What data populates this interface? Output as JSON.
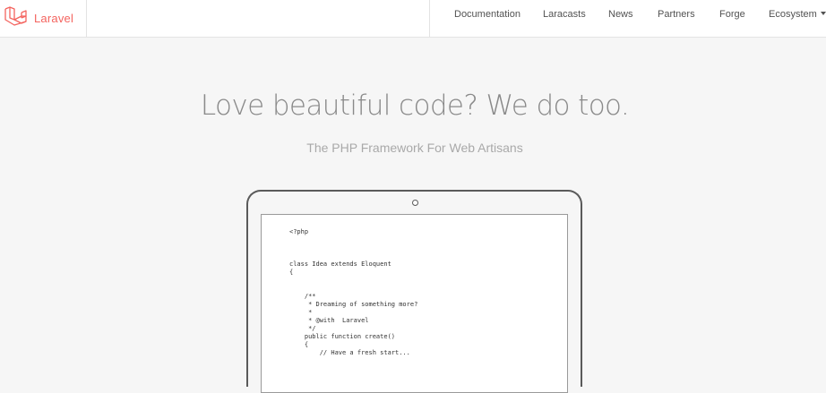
{
  "brand": {
    "name": "Laravel",
    "logo_icon": "laravel-logo-icon",
    "color": "#f4645f"
  },
  "nav": {
    "items": [
      {
        "label": "Documentation"
      },
      {
        "label": "Laracasts"
      },
      {
        "label": "News"
      },
      {
        "label": "Partners"
      },
      {
        "label": "Forge"
      },
      {
        "label": "Ecosystem",
        "has_dropdown": true
      }
    ]
  },
  "hero": {
    "title": "Love beautiful code? We do too.",
    "subtitle": "The PHP Framework For Web Artisans"
  },
  "code_sample": {
    "lines": [
      "<?php",
      "",
      "",
      "",
      "class Idea extends Eloquent",
      "{",
      "",
      "",
      "    /**",
      "     * Dreaming of something more?",
      "     *",
      "     * @with  Laravel",
      "     */",
      "    public function create()",
      "    {",
      "        // Have a fresh start..."
    ]
  }
}
